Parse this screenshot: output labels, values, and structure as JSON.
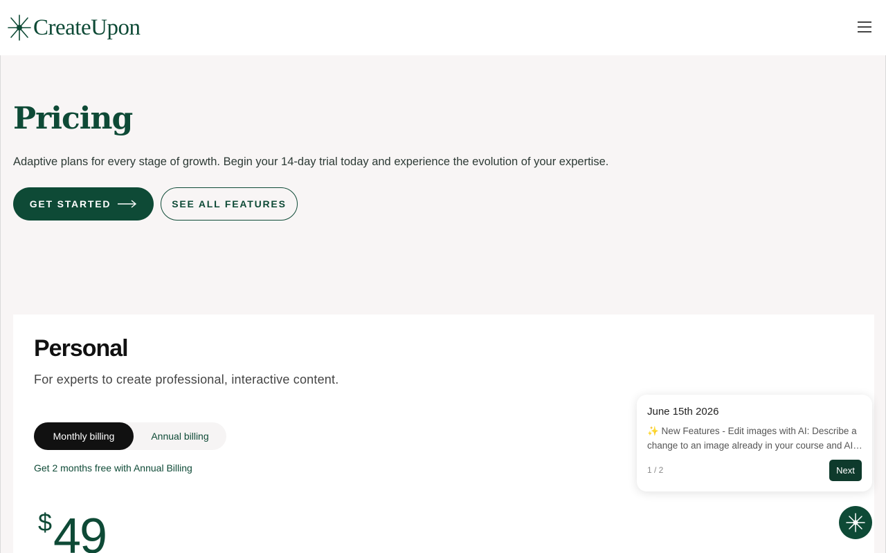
{
  "header": {
    "brand": "CreateUpon",
    "logo_icon": "star-burst-icon",
    "menu_icon": "hamburger-menu-icon"
  },
  "hero": {
    "title": "Pricing",
    "subtitle": "Adaptive plans for every stage of growth. Begin your 14-day trial today and experience the evolution of your expertise.",
    "primary_button": "GET STARTED",
    "primary_button_icon": "arrow-right-icon",
    "secondary_button": "SEE ALL FEATURES"
  },
  "plan": {
    "name": "Personal",
    "description": "For experts to create professional, interactive content.",
    "billing": {
      "monthly": "Monthly billing",
      "annual": "Annual billing",
      "selected": "monthly"
    },
    "promo": "Get 2 months free with Annual Billing",
    "currency": "$",
    "price": "49"
  },
  "announcement": {
    "date": "June 15th 2026",
    "text": "✨ New Features - Edit images with AI: Describe a change to an image already in your course and AI will update it for you.",
    "counter": "1 / 2",
    "next_label": "Next"
  },
  "assistant": {
    "icon": "sparkle-icon"
  },
  "colors": {
    "brand": "#0e4a36",
    "hero_bg": "#f8f5f5",
    "toggle_active": "#111111"
  }
}
